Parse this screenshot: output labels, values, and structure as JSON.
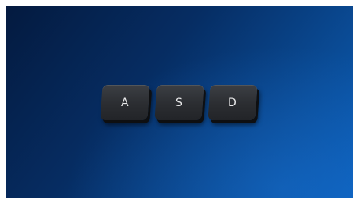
{
  "keys": [
    {
      "label": "A"
    },
    {
      "label": "S"
    },
    {
      "label": "D"
    }
  ]
}
